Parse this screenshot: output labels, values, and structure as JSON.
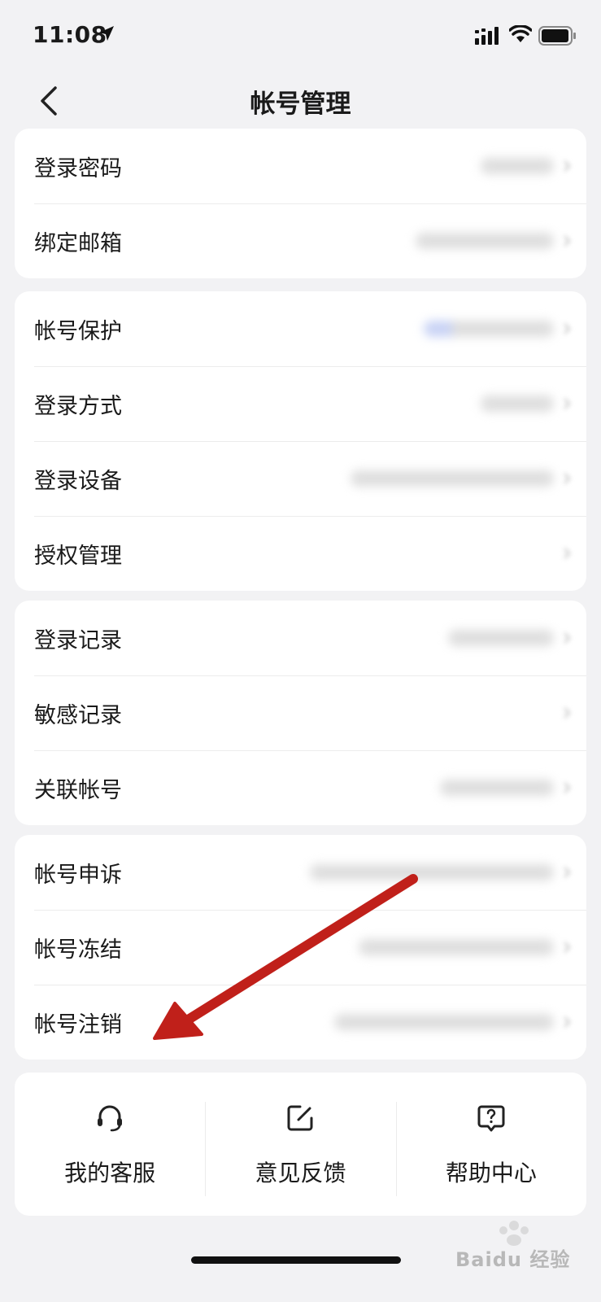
{
  "status_bar": {
    "time": "11:08"
  },
  "header": {
    "title": "帐号管理"
  },
  "groups": [
    {
      "items": [
        {
          "label": "登录密码",
          "blur_w": 90
        },
        {
          "label": "绑定邮箱",
          "blur_w": 170
        }
      ]
    },
    {
      "items": [
        {
          "label": "帐号保护",
          "blur_w": 160
        },
        {
          "label": "登录方式",
          "blur_w": 90
        },
        {
          "label": "登录设备",
          "blur_w": 250
        },
        {
          "label": "授权管理",
          "blur_w": 0
        }
      ]
    },
    {
      "items": [
        {
          "label": "登录记录",
          "blur_w": 130
        },
        {
          "label": "敏感记录",
          "blur_w": 0
        },
        {
          "label": "关联帐号",
          "blur_w": 140
        }
      ]
    },
    {
      "items": [
        {
          "label": "帐号申诉",
          "blur_w": 300
        },
        {
          "label": "帐号冻结",
          "blur_w": 240
        },
        {
          "label": "帐号注销",
          "blur_w": 270
        }
      ]
    }
  ],
  "bottom_bar": [
    {
      "label": "我的客服",
      "icon": "headset-icon"
    },
    {
      "label": "意见反馈",
      "icon": "edit-feedback-icon"
    },
    {
      "label": "帮助中心",
      "icon": "help-question-icon"
    }
  ],
  "watermark": {
    "text": "Baidu 经验",
    "brand": "Bai du"
  },
  "colors": {
    "annotation_arrow": "#c0201a",
    "background": "#f2f2f4",
    "card": "#ffffff"
  }
}
